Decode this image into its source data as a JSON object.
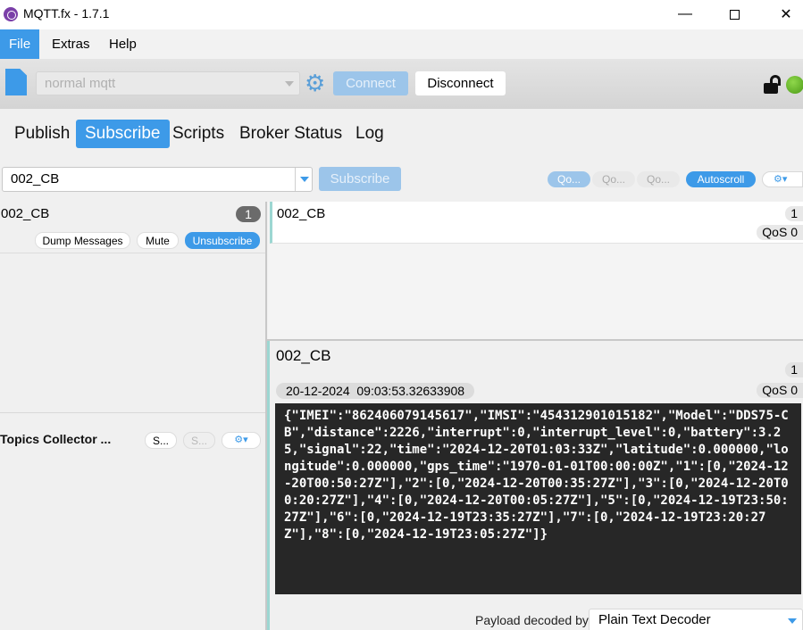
{
  "window": {
    "title": "MQTT.fx - 1.7.1",
    "icon": "mqttfx-logo-icon"
  },
  "menu": {
    "items": [
      "File",
      "Extras",
      "Help"
    ]
  },
  "toolbar": {
    "profile_value": "normal mqtt",
    "connect_label": "Connect",
    "disconnect_label": "Disconnect"
  },
  "tabs": [
    "Publish",
    "Subscribe",
    "Scripts",
    "Broker Status",
    "Log"
  ],
  "subscribe_bar": {
    "topic_value": "002_CB",
    "subscribe_label": "Subscribe",
    "qos_buttons": [
      "Qo...",
      "Qo...",
      "Qo..."
    ],
    "autoscroll_label": "Autoscroll"
  },
  "subscriptions": [
    {
      "topic": "002_CB",
      "count": "1",
      "dump_label": "Dump Messages",
      "mute_label": "Mute",
      "unsubscribe_label": "Unsubscribe"
    }
  ],
  "topics_collector": {
    "label": "Topics Collector ...",
    "btn1": "S...",
    "btn2": "S..."
  },
  "messages": [
    {
      "topic": "002_CB",
      "count": "1",
      "qos": "QoS 0"
    }
  ],
  "detail": {
    "topic": "002_CB",
    "count": "1",
    "timestamp": "20-12-2024  09:03:53.32633908",
    "qos": "QoS 0",
    "payload": "{\"IMEI\":\"862406079145617\",\"IMSI\":\"454312901015182\",\"Model\":\"DDS75-CB\",\"distance\":2226,\"interrupt\":0,\"interrupt_level\":0,\"battery\":3.25,\"signal\":22,\"time\":\"2024-12-20T01:03:33Z\",\"latitude\":0.000000,\"longitude\":0.000000,\"gps_time\":\"1970-01-01T00:00:00Z\",\"1\":[0,\"2024-12-20T00:50:27Z\"],\"2\":[0,\"2024-12-20T00:35:27Z\"],\"3\":[0,\"2024-12-20T00:20:27Z\"],\"4\":[0,\"2024-12-20T00:05:27Z\"],\"5\":[0,\"2024-12-19T23:50:27Z\"],\"6\":[0,\"2024-12-19T23:35:27Z\"],\"7\":[0,\"2024-12-19T23:20:27Z\"],\"8\":[0,\"2024-12-19T23:05:27Z\"]}",
    "decoder_label": "Payload decoded by",
    "decoder_value": "Plain Text Decoder"
  },
  "colors": {
    "accent": "#3d9ae8",
    "accent_disabled": "#9cc5ea",
    "connection_status": "#5fb321"
  }
}
